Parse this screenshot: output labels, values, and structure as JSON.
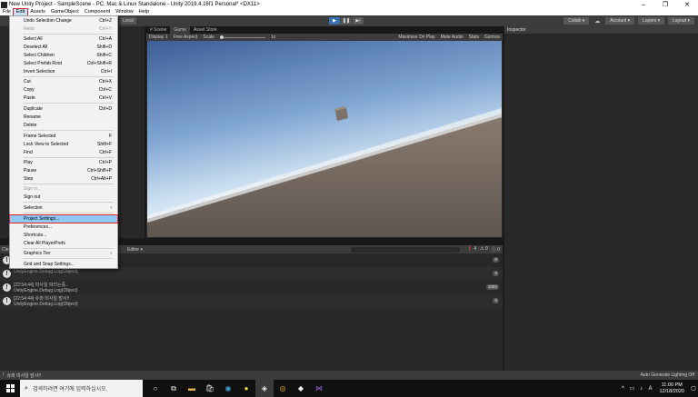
{
  "window": {
    "title": "New Unity Project - SampleScene - PC, Mac & Linux Standalone - Unity 2019.4.16f1 Personal* <DX11>",
    "minimize": "–",
    "maximize": "❐",
    "close": "✕"
  },
  "menubar": [
    "File",
    "Edit",
    "Assets",
    "GameObject",
    "Component",
    "Window",
    "Help"
  ],
  "toolbar": {
    "local_label": "Local",
    "collab": "Collab ▾",
    "account": "Account ▾",
    "layers": "Layers ▾",
    "layout": "Layout ▾",
    "play": "▶",
    "pause": "❚❚",
    "step": "▶|"
  },
  "tabs": {
    "scene": "# Scene",
    "game": "Game",
    "asset_store": "Asset Store",
    "inspector": "Inspector"
  },
  "game_toolbar": {
    "display": "Display 1",
    "aspect": "Free Aspect",
    "scale_label": "Scale",
    "scale_value": "1x",
    "options": [
      "Maximize On Play",
      "Mute Audio",
      "Stats",
      "Gizmos"
    ]
  },
  "edit_menu": {
    "items": [
      {
        "label": "Undo Selection Change",
        "shortcut": "Ctrl+Z"
      },
      {
        "label": "Redo",
        "shortcut": "Ctrl+Y"
      },
      {
        "label": "Select All",
        "shortcut": "Ctrl+A"
      },
      {
        "label": "Deselect All",
        "shortcut": "Shift+D"
      },
      {
        "label": "Select Children",
        "shortcut": "Shift+C"
      },
      {
        "label": "Select Prefab Root",
        "shortcut": "Ctrl+Shift+R"
      },
      {
        "label": "Invert Selection",
        "shortcut": "Ctrl+I"
      },
      {
        "label": "Cut",
        "shortcut": "Ctrl+X"
      },
      {
        "label": "Copy",
        "shortcut": "Ctrl+C"
      },
      {
        "label": "Paste",
        "shortcut": "Ctrl+V"
      },
      {
        "label": "Duplicate",
        "shortcut": "Ctrl+D"
      },
      {
        "label": "Rename",
        "shortcut": ""
      },
      {
        "label": "Delete",
        "shortcut": ""
      },
      {
        "label": "Frame Selected",
        "shortcut": "F"
      },
      {
        "label": "Lock View to Selected",
        "shortcut": "Shift+F"
      },
      {
        "label": "Find",
        "shortcut": "Ctrl+F"
      },
      {
        "label": "Play",
        "shortcut": "Ctrl+P"
      },
      {
        "label": "Pause",
        "shortcut": "Ctrl+Shift+P"
      },
      {
        "label": "Step",
        "shortcut": "Ctrl+Alt+P"
      },
      {
        "label": "Sign in...",
        "shortcut": ""
      },
      {
        "label": "Sign out",
        "shortcut": ""
      },
      {
        "label": "Selection",
        "shortcut": "›"
      },
      {
        "label": "Project Settings...",
        "shortcut": ""
      },
      {
        "label": "Preferences...",
        "shortcut": ""
      },
      {
        "label": "Shortcuts...",
        "shortcut": ""
      },
      {
        "label": "Clear All PlayerPrefs",
        "shortcut": ""
      },
      {
        "label": "Graphics Tier",
        "shortcut": "›"
      },
      {
        "label": "Grid and Snap Settings...",
        "shortcut": ""
      }
    ]
  },
  "console": {
    "clear": "Clea",
    "editor_dropdown": "Editor ▾",
    "counts": [
      "❗ 4",
      "⚠ 0",
      "ⓘ 0"
    ],
    "logs": [
      {
        "line1": "",
        "line2": "",
        "count": "6"
      },
      {
        "line1": "",
        "line2": "UnityEngine.Debug:Log(Object)",
        "count": "6"
      },
      {
        "line1": "[22:54:44] 미사일 파리는중..",
        "line2": "UnityEngine.Debug:Log(Object)",
        "count": "3392"
      },
      {
        "line1": "[22:54:44] 슈퍼 미사일 발사!!",
        "line2": "UnityEngine.Debug:Log(Object)",
        "count": "6"
      }
    ]
  },
  "statusbar": {
    "left": "슈퍼 미사일 발사!!",
    "right": "Auto Generate Lighting Off"
  },
  "taskbar": {
    "search_placeholder": "검색하려면 여기에 입력하십시오.",
    "time": "11:00 PM",
    "date": "12/18/2020",
    "lang": "A"
  }
}
